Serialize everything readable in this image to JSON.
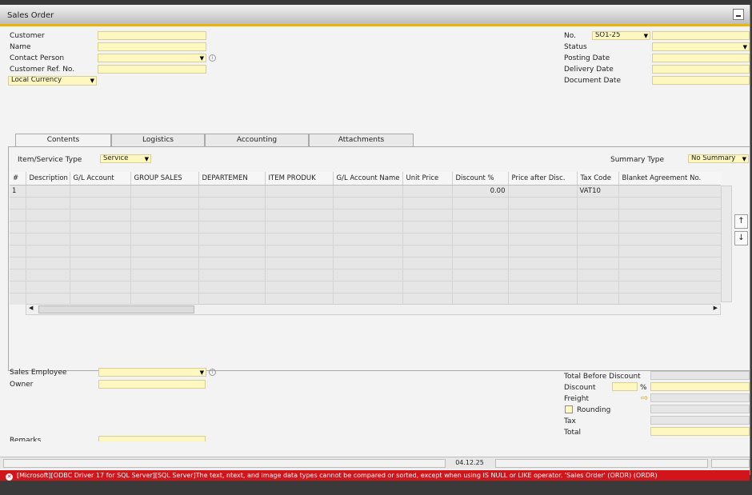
{
  "window": {
    "title": "Sales Order"
  },
  "header_left": {
    "customer_label": "Customer",
    "name_label": "Name",
    "contact_person_label": "Contact Person",
    "customer_ref_label": "Customer Ref. No.",
    "currency_value": "Local Currency"
  },
  "header_right": {
    "no_label": "No.",
    "series_value": "SO1-25",
    "status_label": "Status",
    "posting_date_label": "Posting Date",
    "delivery_date_label": "Delivery Date",
    "document_date_label": "Document Date"
  },
  "tabs": [
    {
      "label": "Contents"
    },
    {
      "label": "Logistics"
    },
    {
      "label": "Accounting"
    },
    {
      "label": "Attachments"
    }
  ],
  "contents": {
    "item_service_type_label": "Item/Service Type",
    "item_service_type_value": "Service",
    "summary_type_label": "Summary Type",
    "summary_type_value": "No Summary"
  },
  "grid": {
    "columns": [
      "#",
      "Description",
      "G/L Account",
      "GROUP SALES",
      "DEPARTEMEN",
      "ITEM PRODUK",
      "G/L Account Name",
      "Unit Price",
      "Discount %",
      "Price after Disc.",
      "Tax Code",
      "Blanket Agreement No."
    ],
    "rows": [
      {
        "num": "1",
        "discount": "0.00",
        "tax_code": "VAT10"
      }
    ]
  },
  "footer_left": {
    "sales_employee_label": "Sales Employee",
    "owner_label": "Owner",
    "remarks_label": "Remarks"
  },
  "totals": {
    "total_before_discount_label": "Total Before Discount",
    "discount_label": "Discount",
    "percent_sign": "%",
    "freight_label": "Freight",
    "rounding_label": "Rounding",
    "tax_label": "Tax",
    "total_label": "Total"
  },
  "status_bar": {
    "date": "04.12.25"
  },
  "error": {
    "icon": "error-icon",
    "message": "[Microsoft][ODBC Driver 17 for SQL Server][SQL Server]The text, ntext, and image data types cannot be compared or sorted, except when using IS NULL or LIKE operator.  'Sales Order' (ORDR) (ORDR)"
  },
  "colors": {
    "accent": "#f0b400",
    "field": "#fff7c0",
    "error": "#d2151b"
  }
}
